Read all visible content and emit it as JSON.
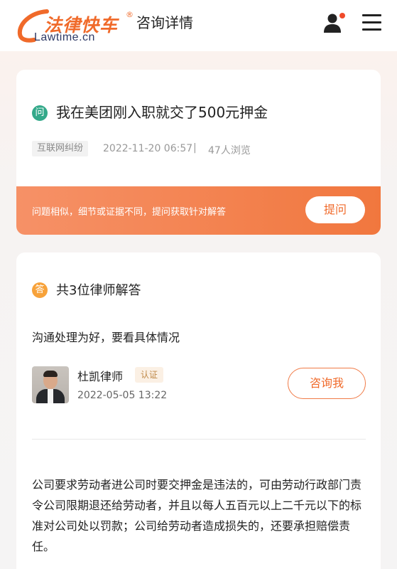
{
  "header": {
    "logo_cn": "法律快车",
    "logo_reg": "®",
    "logo_en": "Lawtime.cn",
    "title": "咨询详情",
    "icons": {
      "user": "user-icon",
      "menu": "menu-icon"
    },
    "notification_dot_color": "#f04a2a"
  },
  "question": {
    "icon_label": "问",
    "title": "我在美团刚入职就交了500元押金",
    "category": "互联网纠纷",
    "date": "2022-11-20 06:57",
    "separator": "|",
    "views": "47人浏览",
    "banner_text": "问题相似，细节或证据不同，提问获取针对解答",
    "ask_button": "提问"
  },
  "answers": {
    "icon_label": "答",
    "heading": "共3位律师解答",
    "first": {
      "text": "沟通处理为好，要看具体情况",
      "lawyer_name": "杜凯律师",
      "badge": "认证",
      "date": "2022-05-05 13:22",
      "consult_button": "咨询我"
    },
    "second": {
      "text": "公司要求劳动者进公司时要交押金是违法的，可由劳动行政部门责令公司限期退还给劳动者，并且以每人五百元以上二千元以下的标准对公司处以罚款；公司给劳动者造成损失的，还要承担赔偿责任。"
    }
  },
  "colors": {
    "brand_orange": "#f06a2a",
    "question_icon": "#34a98a",
    "answer_icon": "#f7a23a",
    "banner_gradient": [
      "#f69167",
      "#f1773e"
    ]
  }
}
